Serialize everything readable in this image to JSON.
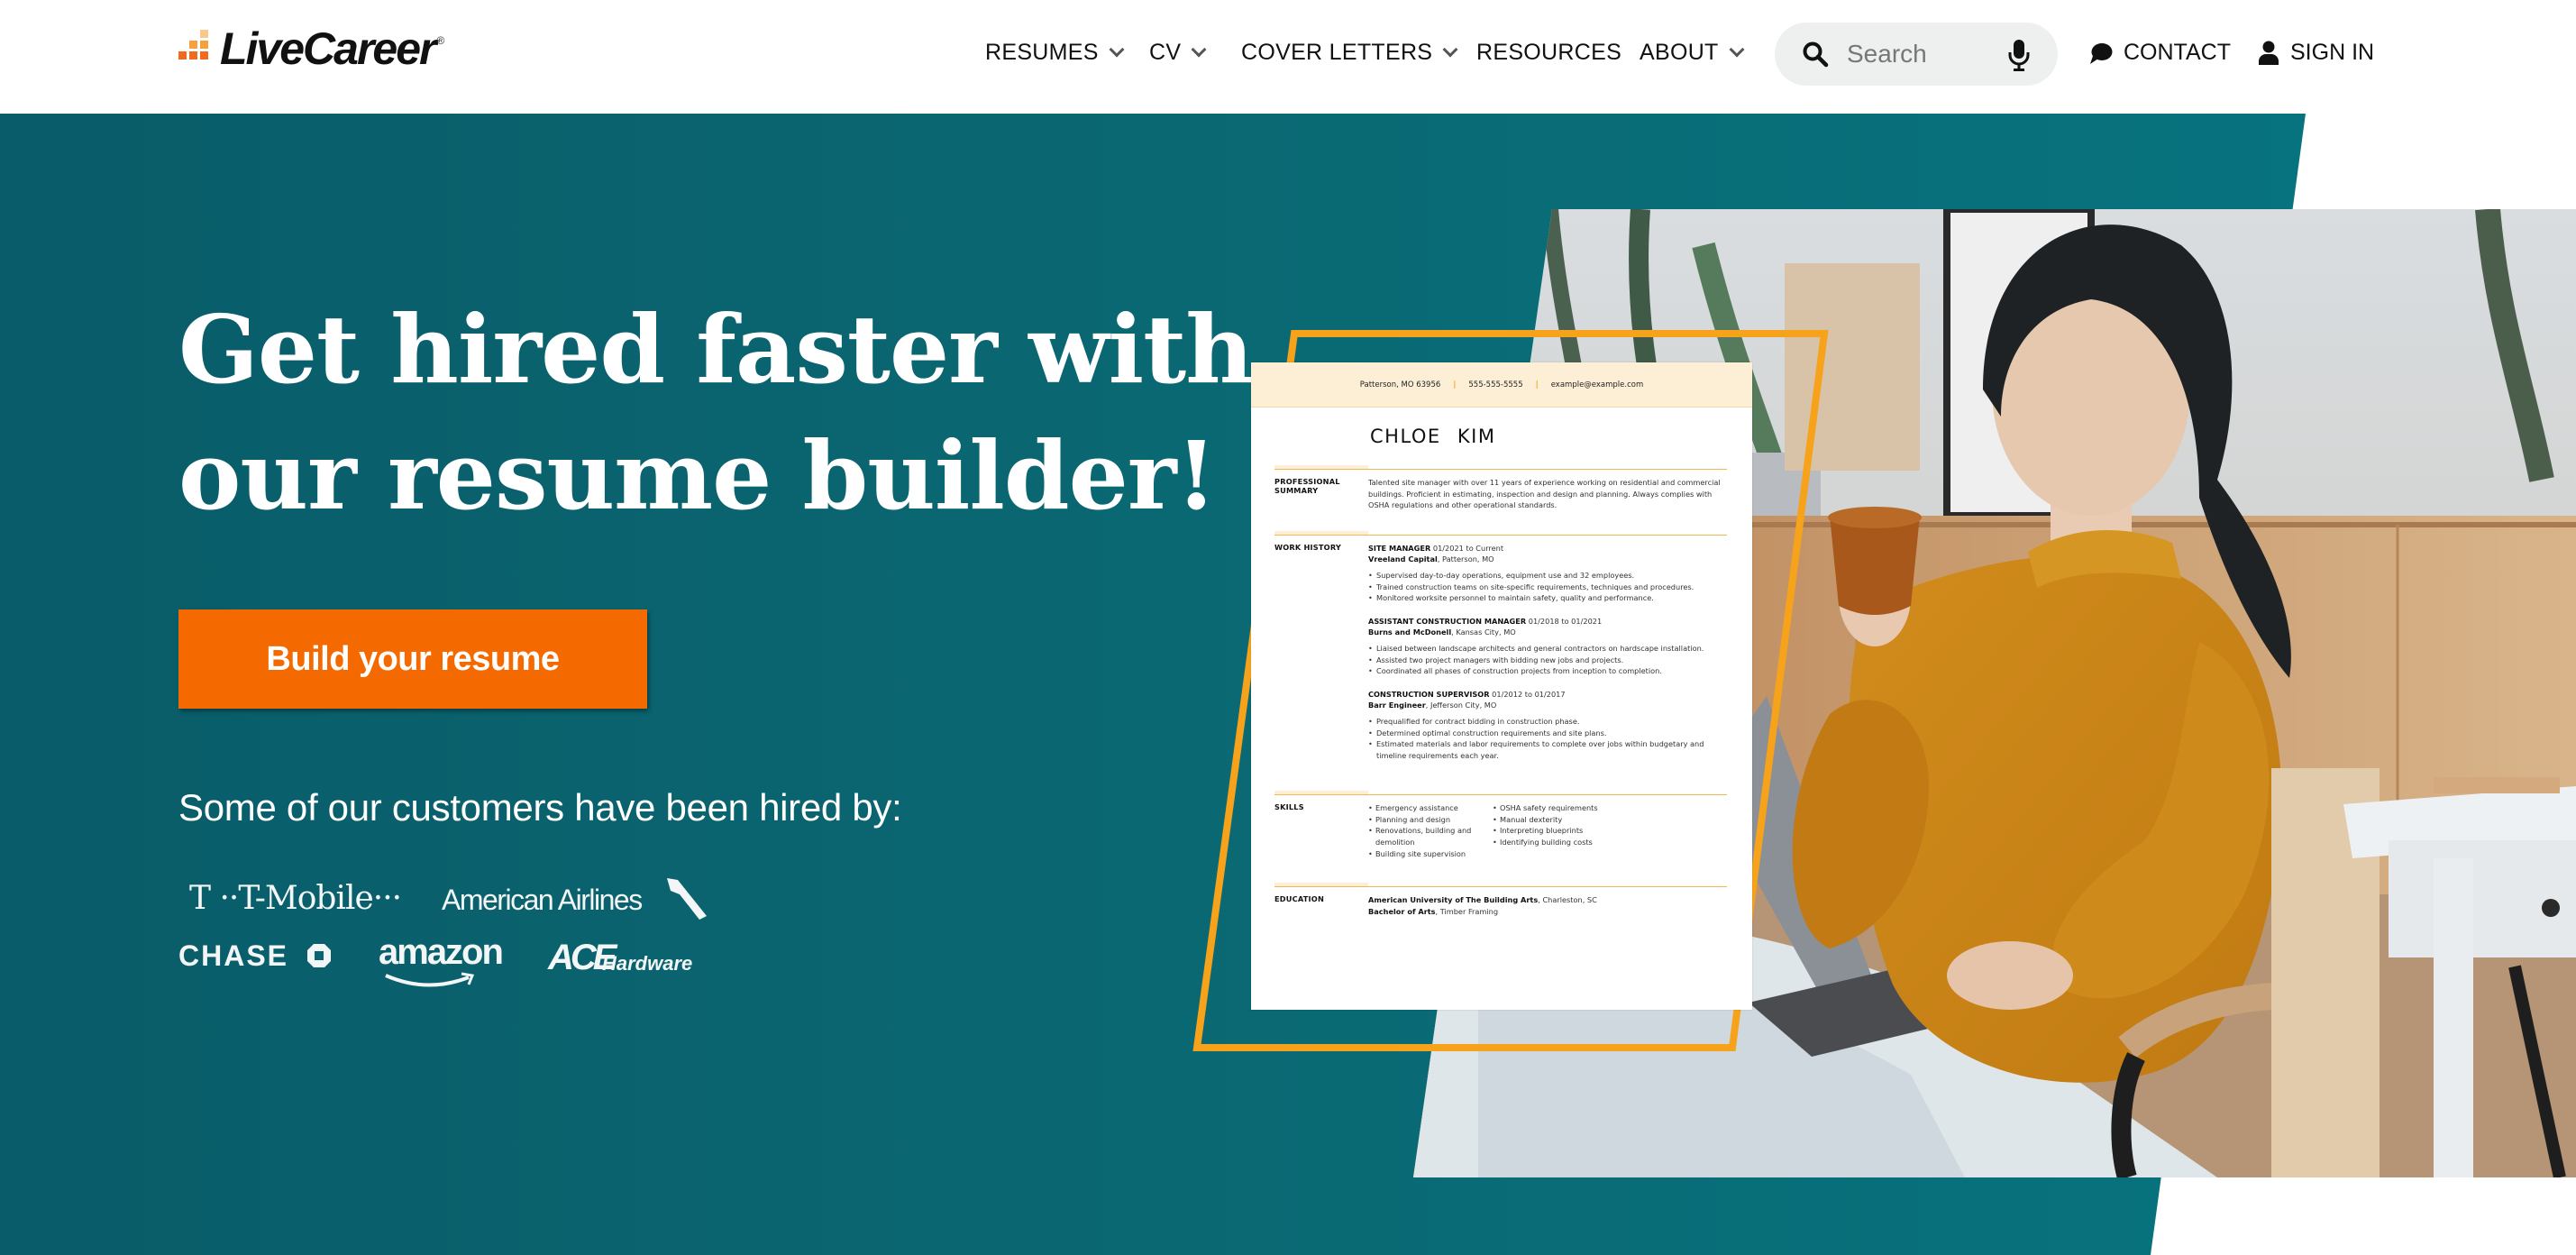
{
  "header": {
    "logo_text": "LiveCareer",
    "logo_reg": "®",
    "nav": [
      {
        "label": "RESUMES",
        "has_dropdown": true
      },
      {
        "label": "CV",
        "has_dropdown": true
      },
      {
        "label": "COVER LETTERS",
        "has_dropdown": true
      },
      {
        "label": "RESOURCES",
        "has_dropdown": false
      },
      {
        "label": "ABOUT",
        "has_dropdown": true
      }
    ],
    "search": {
      "placeholder": "Search",
      "value": "",
      "icon": "search-icon",
      "voice_icon": "microphone-icon"
    },
    "contact_label": "CONTACT",
    "contact_icon": "chat-bubble-icon",
    "signin_label": "SIGN IN",
    "signin_icon": "user-icon"
  },
  "hero": {
    "headline_line1": "Get hired faster with",
    "headline_line2": "our resume builder!",
    "cta_label": "Build your resume",
    "hired_by_text": "Some of our customers have been hired by:",
    "companies": [
      "T-Mobile",
      "American Airlines",
      "CHASE",
      "amazon",
      "ACE",
      "Hardware"
    ]
  },
  "resume": {
    "contact_city": "Patterson, MO 63956",
    "contact_phone": "555-555-5555",
    "contact_email": "example@example.com",
    "separator": "|",
    "name": "CHLOE KIM",
    "summary_label_1": "PROFESSIONAL",
    "summary_label_2": "SUMMARY",
    "summary_text": "Talented site manager with over 11 years of experience working on residential and commercial buildings. Proficient in estimating, inspection and design and planning. Always complies with OSHA regulations and other operational standards.",
    "work_label": "WORK HISTORY",
    "jobs": [
      {
        "title": "SITE MANAGER",
        "dates": " 01/2021 to Current",
        "company": "Vreeland Capital",
        "location": ", Patterson, MO",
        "bullets": [
          "Supervised day-to-day operations, equipment use and 32 employees.",
          "Trained construction teams on site-specific requirements, techniques and procedures.",
          "Monitored worksite personnel to maintain safety, quality and performance."
        ]
      },
      {
        "title": "ASSISTANT CONSTRUCTION MANAGER",
        "dates": " 01/2018 to 01/2021",
        "company": "Burns and McDonell",
        "location": ", Kansas City, MO",
        "bullets": [
          "Liaised between landscape architects and general contractors on hardscape installation.",
          "Assisted two project managers with bidding new jobs and projects.",
          "Coordinated all phases of construction projects from inception to completion."
        ]
      },
      {
        "title": "CONSTRUCTION SUPERVISOR",
        "dates": " 01/2012 to 01/2017",
        "company": "Barr Engineer",
        "location": ", Jefferson City, MO",
        "bullets": [
          "Prequalified for contract bidding in construction phase.",
          "Determined optimal construction requirements and site plans.",
          "Estimated materials and labor requirements to complete over jobs within budgetary and timeline requirements each year."
        ]
      }
    ],
    "skills_label": "SKILLS",
    "skills_col1": [
      "Emergency assistance",
      "Planning and design",
      "Renovations, building and demolition",
      "Building site supervision"
    ],
    "skills_col2": [
      "OSHA safety requirements",
      "Manual dexterity",
      "Interpreting blueprints",
      "Identifying building costs"
    ],
    "education_label": "EDUCATION",
    "school": "American University of The Building Arts",
    "school_location": ", Charleston, SC",
    "degree": "Bachelor of Arts",
    "degree_field": ", Timber Framing"
  },
  "colors": {
    "brand_orange": "#f46a00",
    "frame_orange": "#f7a21b",
    "teal": "#0a6d77",
    "resume_header_bg": "#fdefd6"
  }
}
